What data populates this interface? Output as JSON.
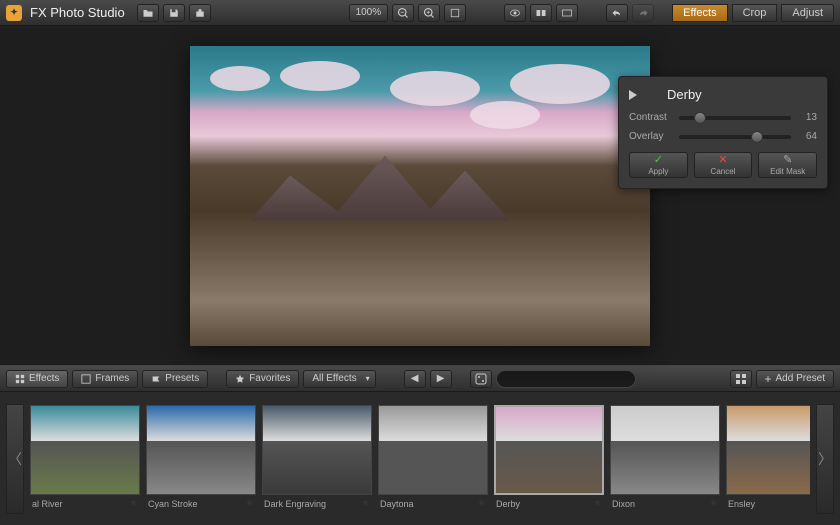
{
  "app_title": "FX Photo Studio",
  "zoom_label": "100%",
  "modes": {
    "effects": "Effects",
    "crop": "Crop",
    "adjust": "Adjust",
    "active": "effects"
  },
  "panel": {
    "title": "Derby",
    "sliders": [
      {
        "label": "Contrast",
        "value": 13,
        "min": 0,
        "max": 100
      },
      {
        "label": "Overlay",
        "value": 64,
        "min": 0,
        "max": 100
      }
    ],
    "buttons": {
      "apply": "Apply",
      "cancel": "Cancel",
      "edit_mask": "Edit Mask"
    }
  },
  "btabs": {
    "effects": "Effects",
    "frames": "Frames",
    "presets": "Presets",
    "favorites": "Favorites"
  },
  "filter_dropdown": "All Effects",
  "add_preset": "Add Preset",
  "thumbs": [
    {
      "name": "al River",
      "sky": "#3a8a9a",
      "land": "#6a7a4a"
    },
    {
      "name": "Cyan Stroke",
      "sky": "#2a6aaa",
      "land": "#888"
    },
    {
      "name": "Dark Engraving",
      "sky": "#4a5a6a",
      "land": "#3a3a3a"
    },
    {
      "name": "Daytona",
      "sky": "#999",
      "land": "#555"
    },
    {
      "name": "Derby",
      "sky": "#d8a8c8",
      "land": "#6a5a4a",
      "selected": true
    },
    {
      "name": "Dixon",
      "sky": "#ccc",
      "land": "#888"
    },
    {
      "name": "Ensley",
      "sky": "#c89a6a",
      "land": "#8a6a4a"
    }
  ]
}
